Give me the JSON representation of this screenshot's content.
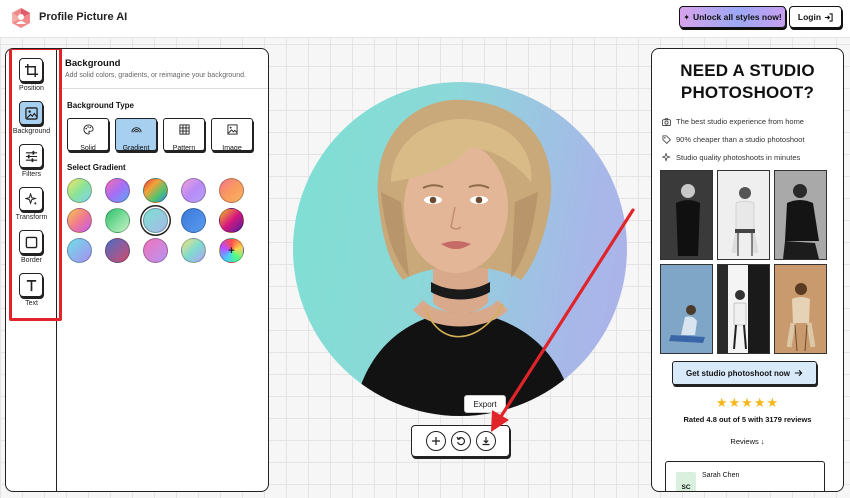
{
  "app": {
    "title": "Profile Picture AI"
  },
  "header": {
    "unlock_label": "Unlock all styles now!",
    "login_label": "Login"
  },
  "tools": [
    {
      "label": "Position",
      "icon": "crop-icon"
    },
    {
      "label": "Background",
      "icon": "image-icon",
      "active": true
    },
    {
      "label": "Filters",
      "icon": "sliders-icon"
    },
    {
      "label": "Transform",
      "icon": "sparkle-icon"
    },
    {
      "label": "Border",
      "icon": "square-icon"
    },
    {
      "label": "Text",
      "icon": "text-icon"
    }
  ],
  "background_panel": {
    "title": "Background",
    "subtitle": "Add solid colors, gradients, or reimagine your background.",
    "type_label": "Background Type",
    "types": [
      {
        "label": "Solid",
        "icon": "palette-icon"
      },
      {
        "label": "Gradient",
        "icon": "rainbow-icon",
        "selected": true
      },
      {
        "label": "Pattern",
        "icon": "grid-icon"
      },
      {
        "label": "Image",
        "icon": "image-icon"
      }
    ],
    "gradient_label": "Select Gradient",
    "selected_gradient_index": 7,
    "gradients": [
      "linear-gradient(135deg,#f5e663,#8ae39a,#7ed0f2)",
      "linear-gradient(135deg,#fb6bb0,#a66ef5,#58a8f5)",
      "linear-gradient(135deg,#e33b3b,#f2a33a,#4fc36e,#3a7ee8)",
      "linear-gradient(135deg,#f1a0d9,#b98af5,#b4a2f8)",
      "linear-gradient(135deg,#f8768c,#f99b5f,#f8b363)",
      "linear-gradient(135deg,#f7c64e,#f07a8e,#c35cf0)",
      "linear-gradient(135deg,#2fbf6c,#7bdc9a,#c9f1c6)",
      "linear-gradient(135deg,#7ee0d3,#a6b9e8)",
      "linear-gradient(135deg,#3a78d8,#5a9cf0)",
      "linear-gradient(135deg,#f2bf23,#d7187e,#4a1da0)",
      "linear-gradient(135deg,#6fe0e8,#a78ef0)",
      "linear-gradient(135deg,#4d6fc7,#d04a6c)",
      "linear-gradient(135deg,#f072b8,#b795f5)",
      "linear-gradient(135deg,#f6e27c,#7edbd0,#b4a0f3)",
      "conic-gradient(#ff4d4d,#ffd24d,#4dff88,#4dc3ff,#b84dff,#ff4d4d)"
    ],
    "custom_label": "+"
  },
  "canvas": {
    "tooltip": "Export"
  },
  "promo": {
    "title": "NEED A STUDIO PHOTOSHOOT?",
    "bullets": [
      "The best studio experience from home",
      "90% cheaper than a studio photoshoot",
      "Studio quality photoshoots in minutes"
    ],
    "cta": "Get studio photoshoot now",
    "stars": "★★★★★",
    "rating": "Rated 4.8 out of 5 with 3179 reviews",
    "reviews_link": "Reviews ↓",
    "review": {
      "initials": "SC",
      "name": "Sarah Chen"
    }
  },
  "colors": {
    "highlight": "#e0242a",
    "accent": "#a7cff0",
    "star": "#f5b819"
  }
}
